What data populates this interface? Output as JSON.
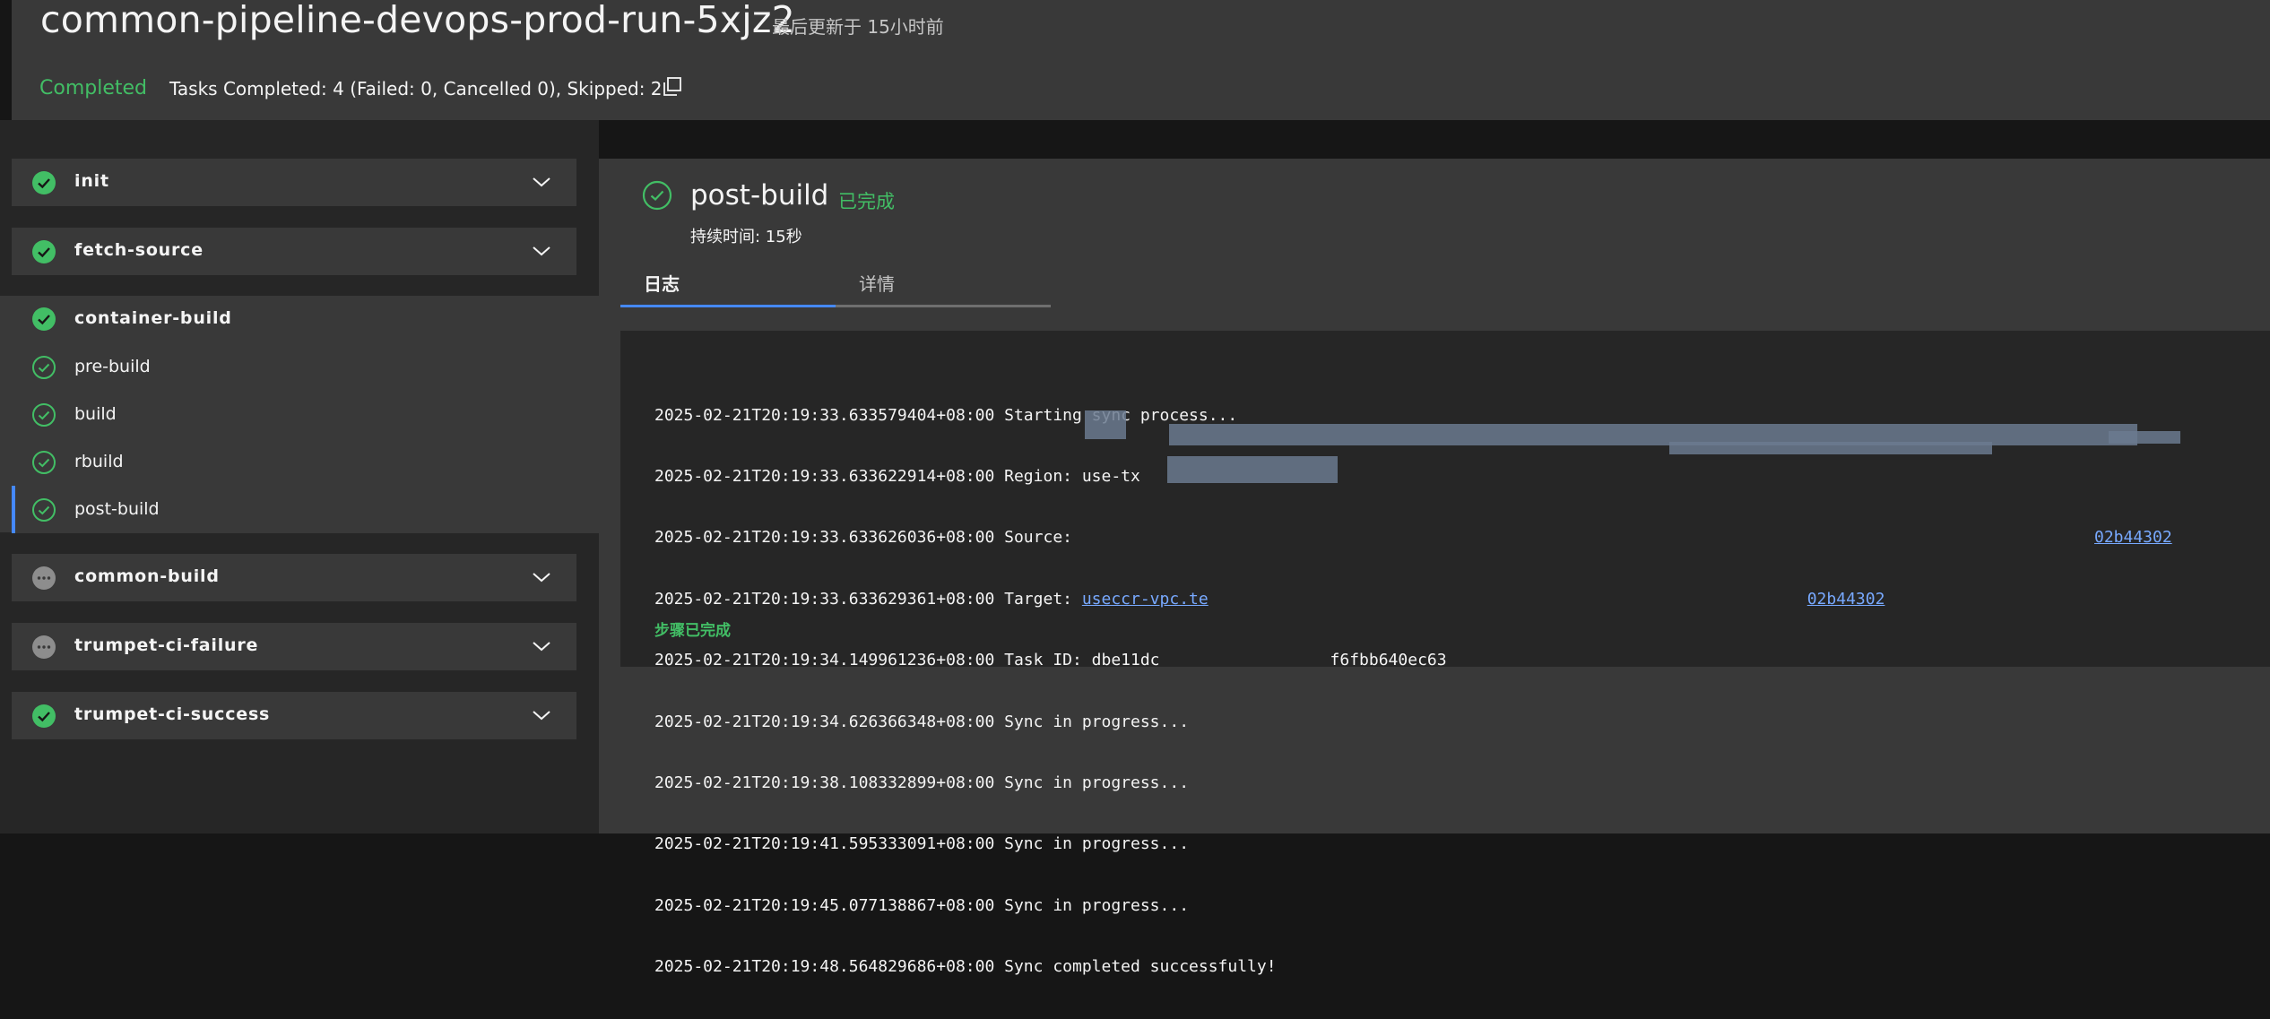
{
  "header": {
    "title": "common-pipeline-devops-prod-run-5xjz2",
    "updated": "最后更新于 15小时前",
    "status": "Completed",
    "summary": "Tasks Completed: 4 (Failed: 0, Cancelled 0), Skipped: 2"
  },
  "tasks_top": [
    {
      "name": "init",
      "status": "success"
    },
    {
      "name": "fetch-source",
      "status": "success"
    }
  ],
  "expanded_task": {
    "name": "container-build",
    "status": "success",
    "steps": [
      {
        "label": "pre-build"
      },
      {
        "label": "build"
      },
      {
        "label": "rbuild"
      },
      {
        "label": "post-build"
      }
    ]
  },
  "tasks_bottom": [
    {
      "name": "common-build",
      "status": "skipped"
    },
    {
      "name": "trumpet-ci-failure",
      "status": "skipped"
    },
    {
      "name": "trumpet-ci-success",
      "status": "success"
    }
  ],
  "step_detail": {
    "title": "post-build",
    "status": "已完成",
    "duration": "持续时间: 15秒",
    "tabs": [
      "日志",
      "详情"
    ]
  },
  "log": {
    "lines": [
      {
        "text": "2025-02-21T20:19:33.633579404+08:00 Starting sync process..."
      },
      {
        "text": "2025-02-21T20:19:33.633622914+08:00 Region: use-tx"
      },
      {
        "text": "2025-02-21T20:19:33.633626036+08:00 Source:",
        "link": "02b44302"
      },
      {
        "text": "2025-02-21T20:19:33.633629361+08:00 Target: ",
        "link": "useccr-vpc.te",
        "link2": "02b44302"
      },
      {
        "text": "2025-02-21T20:19:34.149961236+08:00 Task ID: dbe11dc",
        "tail": "f6fbb640ec63"
      },
      {
        "text": "2025-02-21T20:19:34.626366348+08:00 Sync in progress..."
      },
      {
        "text": "2025-02-21T20:19:38.108332899+08:00 Sync in progress..."
      },
      {
        "text": "2025-02-21T20:19:41.595333091+08:00 Sync in progress..."
      },
      {
        "text": "2025-02-21T20:19:45.077138867+08:00 Sync in progress..."
      },
      {
        "text": "2025-02-21T20:19:48.564829686+08:00 Sync completed successfully!"
      }
    ],
    "footer": "步骤已完成"
  },
  "colors": {
    "success": "#42be65",
    "skipped": "#8d8d8d",
    "accent": "#4589ff",
    "link": "#78a9ff"
  }
}
